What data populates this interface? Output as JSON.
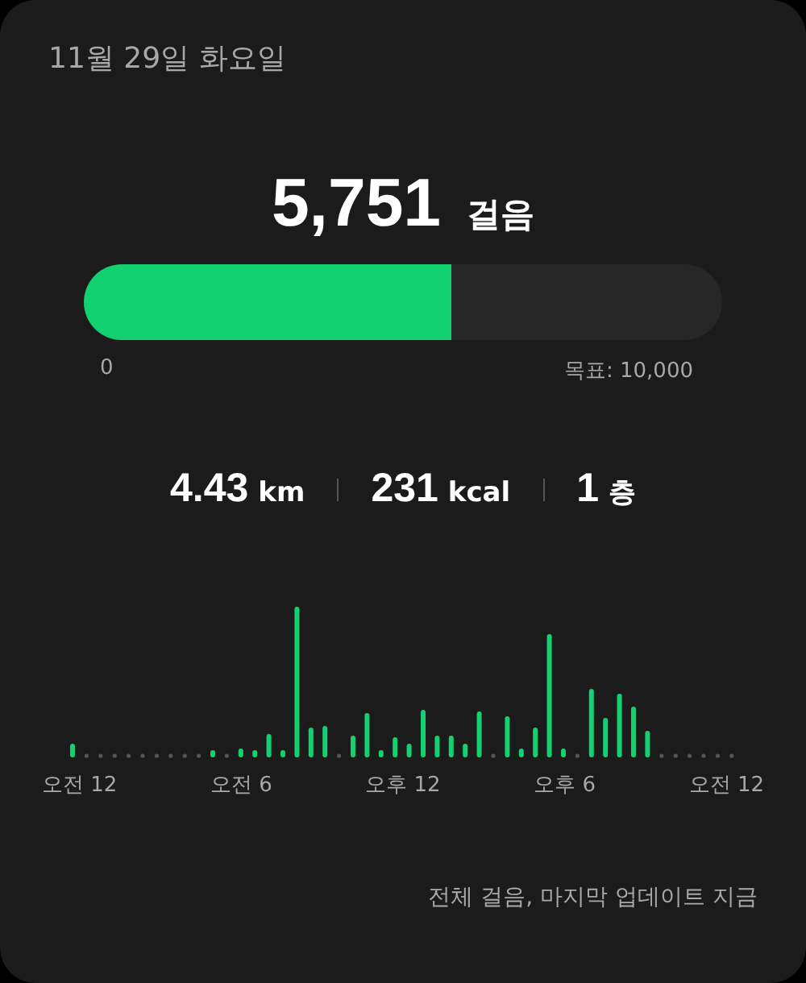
{
  "date": "11월 29일 화요일",
  "steps": {
    "count": "5,751",
    "unit": "걸음",
    "level": 0.5751,
    "min_label": "0",
    "goal_label": "목표: 10,000"
  },
  "stats": [
    {
      "value": "4.43",
      "unit": "km"
    },
    {
      "value": "231",
      "unit": "kcal"
    },
    {
      "value": "1",
      "unit": "층"
    }
  ],
  "chart": {
    "x_labels": [
      "오전 12",
      "오전 6",
      "오후 12",
      "오후 6",
      "오전 12"
    ]
  },
  "footer": "전체 걸음, 마지막 업데이트 지금"
}
